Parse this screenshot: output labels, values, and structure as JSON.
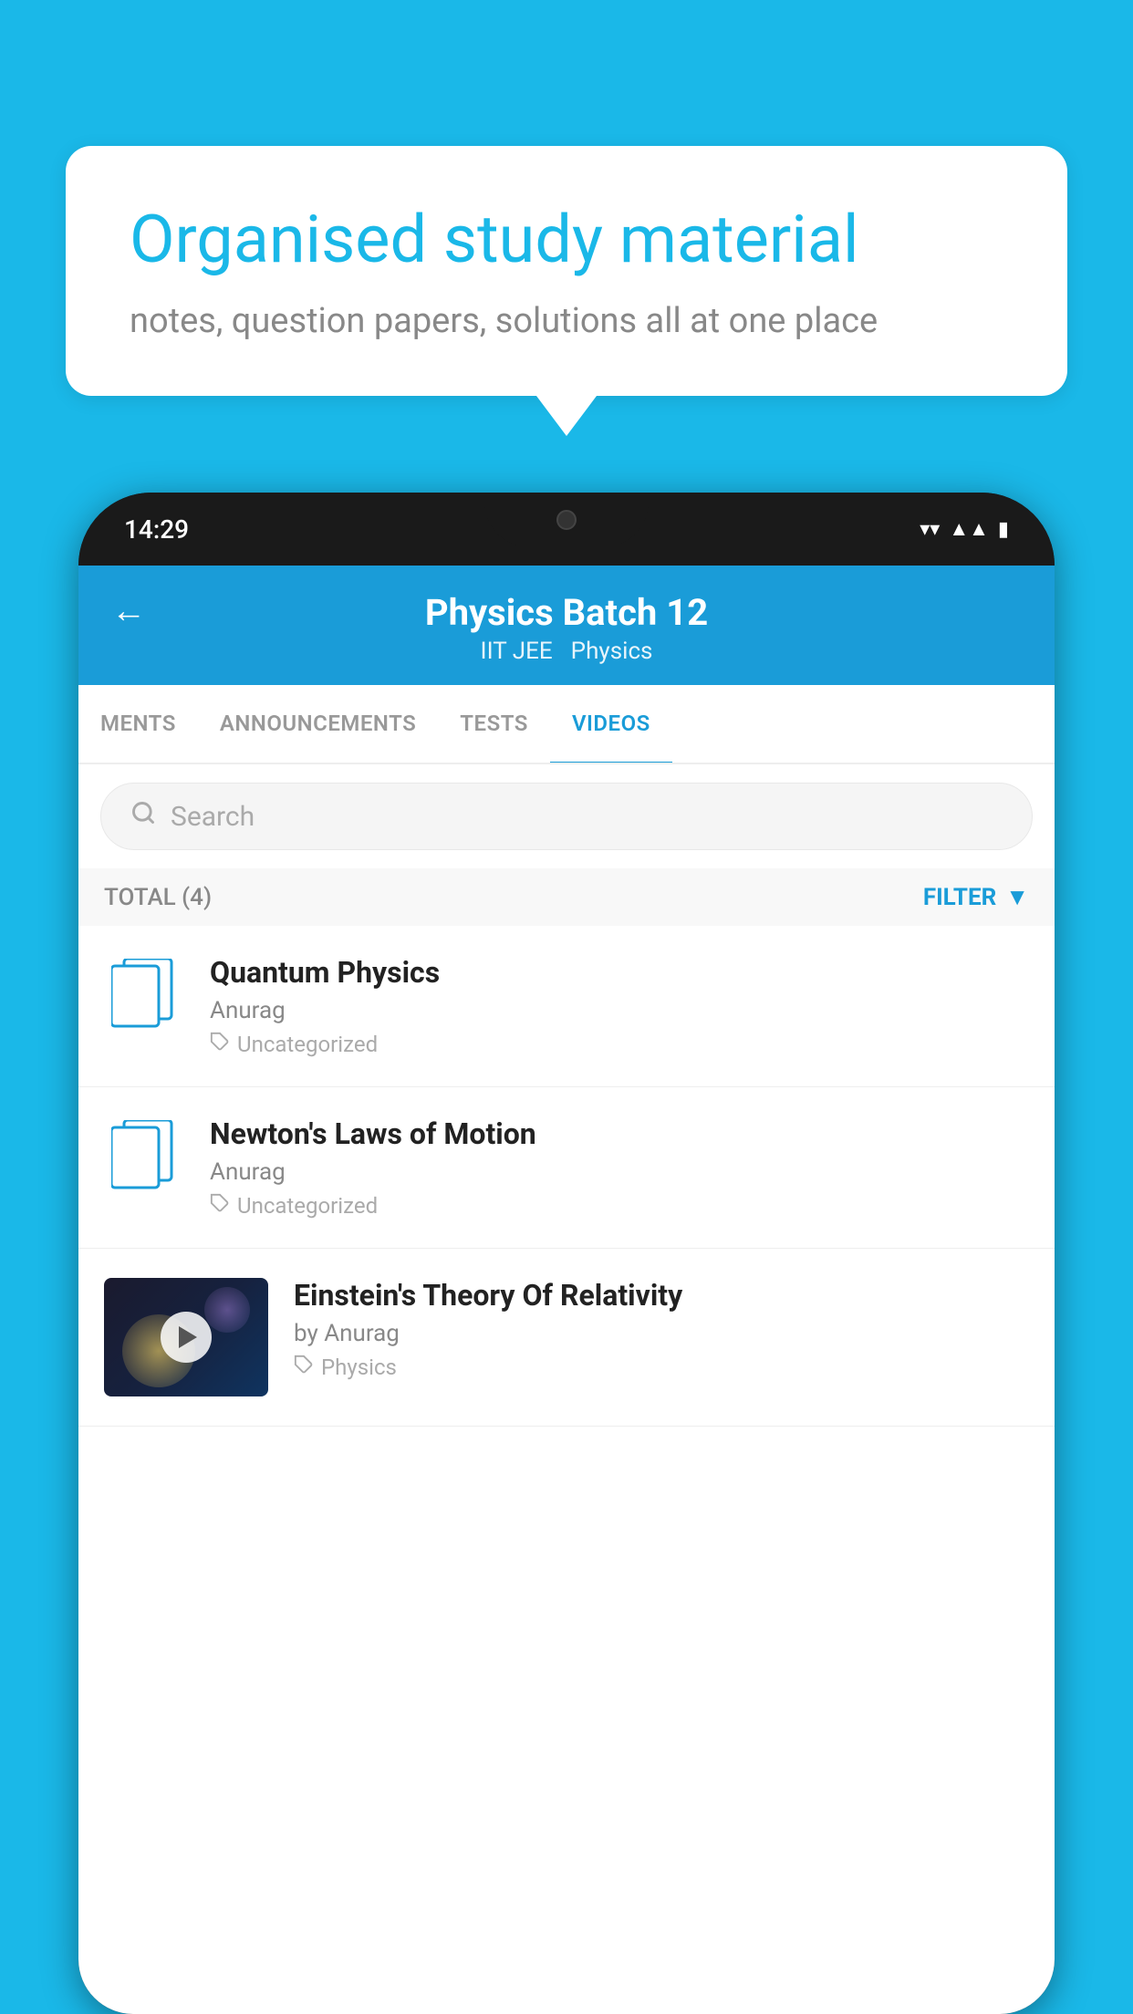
{
  "background": {
    "color": "#1ab8e8"
  },
  "speech_bubble": {
    "title": "Organised study material",
    "subtitle": "notes, question papers, solutions all at one place"
  },
  "phone": {
    "status_bar": {
      "time": "14:29"
    },
    "app_header": {
      "back_label": "←",
      "title": "Physics Batch 12",
      "subtitle_part1": "IIT JEE",
      "subtitle_part2": "Physics"
    },
    "tabs": [
      {
        "label": "MENTS",
        "active": false
      },
      {
        "label": "ANNOUNCEMENTS",
        "active": false
      },
      {
        "label": "TESTS",
        "active": false
      },
      {
        "label": "VIDEOS",
        "active": true
      }
    ],
    "search": {
      "placeholder": "Search"
    },
    "filter_row": {
      "total_label": "TOTAL (4)",
      "filter_label": "FILTER"
    },
    "video_items": [
      {
        "id": 1,
        "title": "Quantum Physics",
        "author": "Anurag",
        "tag": "Uncategorized",
        "has_thumbnail": false
      },
      {
        "id": 2,
        "title": "Newton's Laws of Motion",
        "author": "Anurag",
        "tag": "Uncategorized",
        "has_thumbnail": false
      },
      {
        "id": 3,
        "title": "Einstein's Theory Of Relativity",
        "author": "by Anurag",
        "tag": "Physics",
        "has_thumbnail": true
      }
    ]
  }
}
